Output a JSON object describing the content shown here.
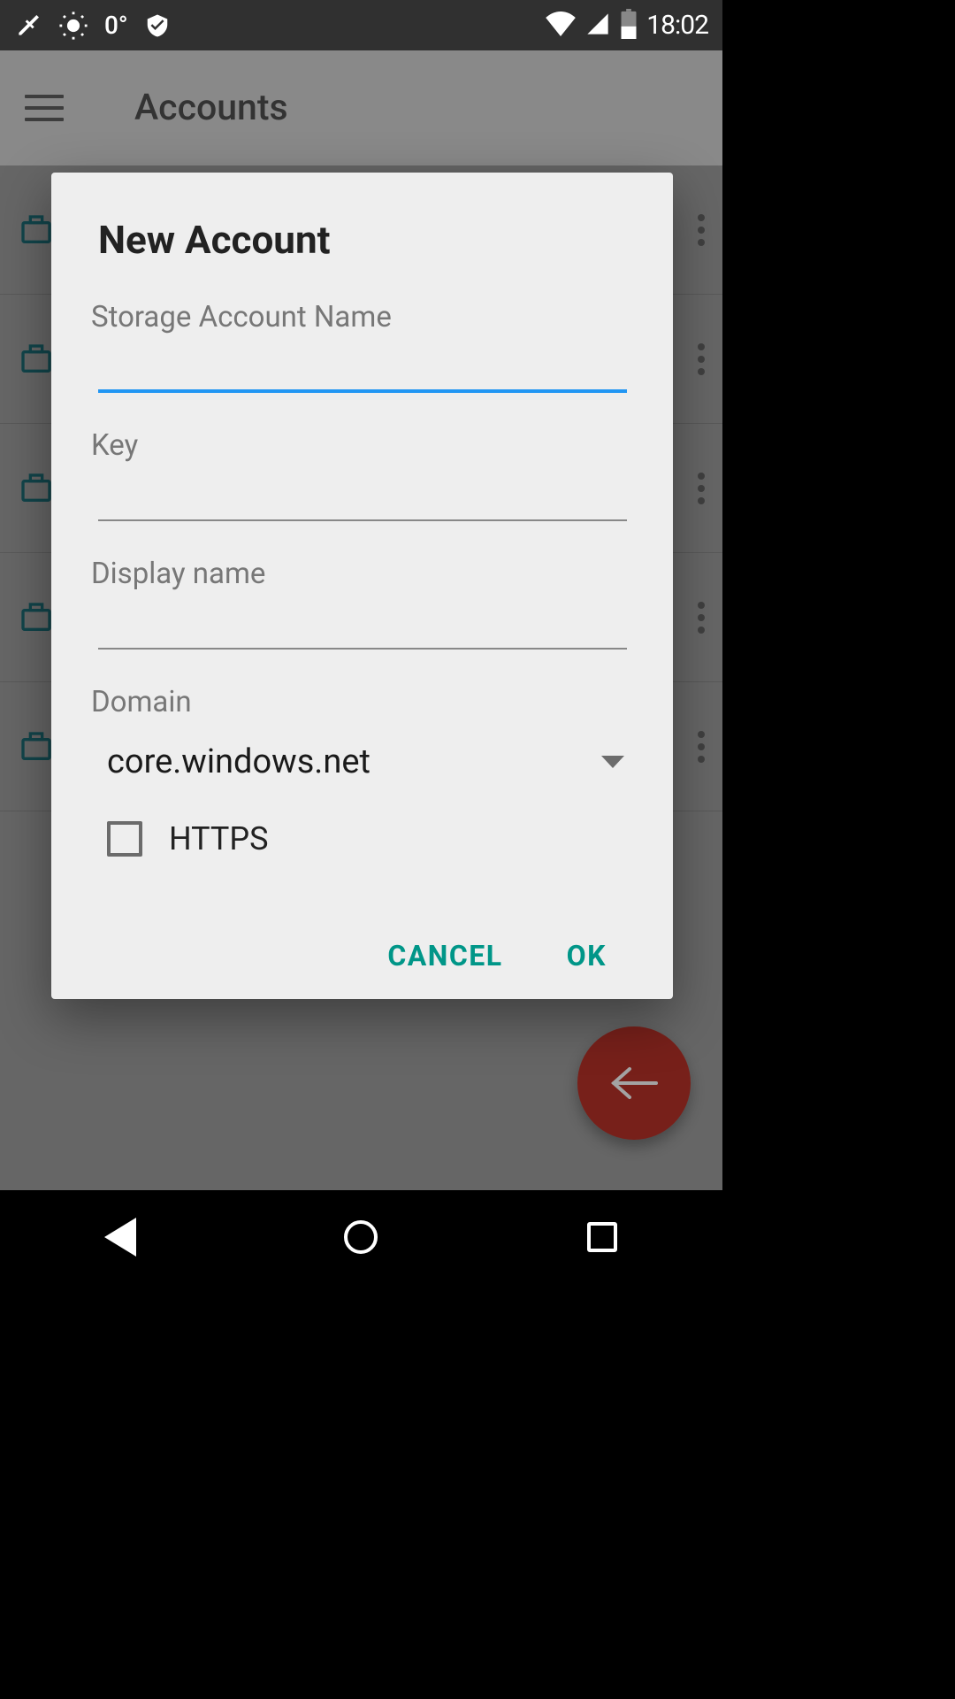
{
  "status_bar": {
    "temp": "0°",
    "time": "18:02"
  },
  "header": {
    "title": "Accounts"
  },
  "dialog": {
    "title": "New Account",
    "fields": {
      "storage_label": "Storage Account Name",
      "storage_value": "",
      "key_label": "Key",
      "key_value": "",
      "display_name_label": "Display name",
      "display_name_value": "",
      "domain_label": "Domain",
      "domain_value": "core.windows.net",
      "https_label": "HTTPS",
      "https_checked": false
    },
    "actions": {
      "cancel": "CANCEL",
      "ok": "OK"
    }
  }
}
